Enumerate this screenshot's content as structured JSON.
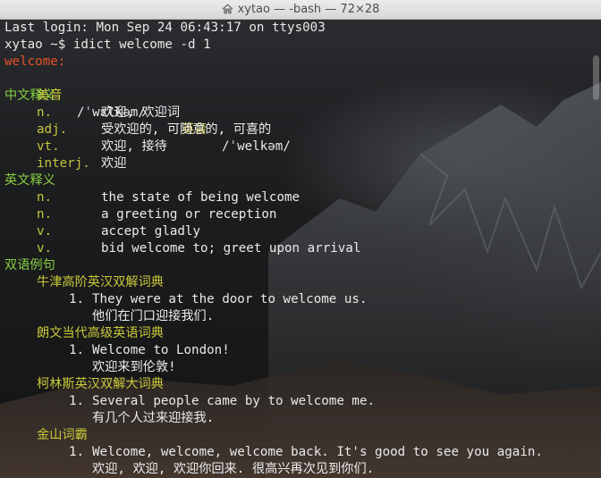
{
  "window": {
    "title": "xytao — -bash — 72×28"
  },
  "terminal": {
    "last_login": "Last login: Mon Sep 24 06:43:17 on ttys003",
    "prompt": "xytao ~$ idict welcome -d 1",
    "word": "welcome:",
    "pron_us_label": "美音",
    "pron_us": "/ˈwɛlkəm/",
    "pron_uk_label": "英音",
    "pron_uk": "/ˈwelkəm/",
    "cn_section": "中文释义",
    "cn_defs": [
      {
        "pos": "n.",
        "def": "欢迎, 欢迎词"
      },
      {
        "pos": "adj.",
        "def": "受欢迎的, 可随意的, 可喜的"
      },
      {
        "pos": "vt.",
        "def": "欢迎, 接待"
      },
      {
        "pos": "interj.",
        "def": "欢迎"
      }
    ],
    "en_section": "英文释义",
    "en_defs": [
      {
        "pos": "n.",
        "def": "the state of being welcome"
      },
      {
        "pos": "n.",
        "def": "a greeting or reception"
      },
      {
        "pos": "v.",
        "def": "accept gladly"
      },
      {
        "pos": "v.",
        "def": "bid welcome to; greet upon arrival"
      }
    ],
    "ex_section": "双语例句",
    "sources": [
      {
        "name": "牛津高阶英汉双解词典",
        "num": "1.",
        "en": "They were at the door to welcome us.",
        "zh": "他们在门口迎接我们."
      },
      {
        "name": "朗文当代高级英语词典",
        "num": "1.",
        "en": "Welcome to London!",
        "zh": "欢迎来到伦敦!"
      },
      {
        "name": "柯林斯英汉双解大词典",
        "num": "1.",
        "en": "Several people came by to welcome me.",
        "zh": "有几个人过来迎接我."
      },
      {
        "name": "金山词霸",
        "num": "1.",
        "en": "Welcome, welcome, welcome back. It's good to see you again.",
        "zh": "欢迎, 欢迎, 欢迎你回来. 很高兴再次见到你们."
      }
    ]
  }
}
